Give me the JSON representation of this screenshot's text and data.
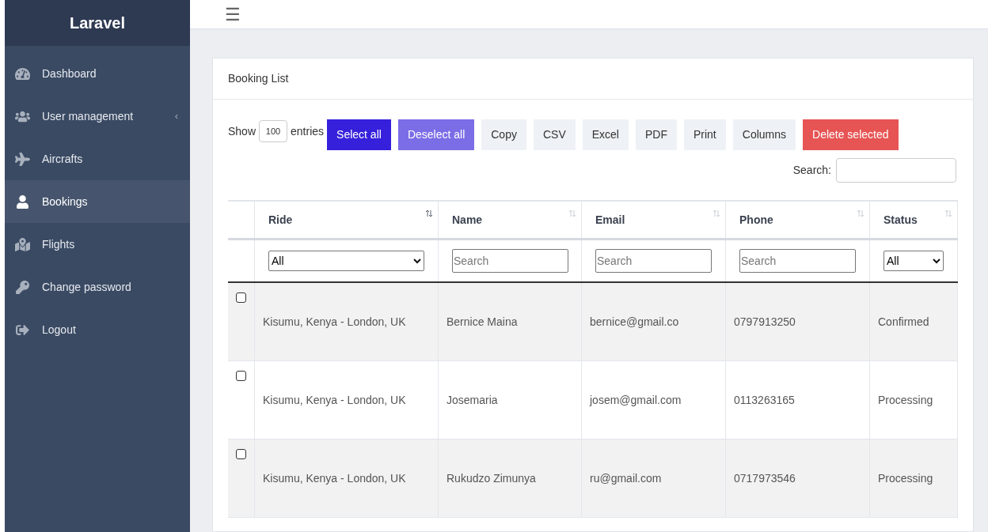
{
  "sidebar": {
    "brand": "Laravel",
    "items": [
      {
        "label": "Dashboard",
        "selected": false
      },
      {
        "label": "User management",
        "selected": false,
        "caret": "‹"
      },
      {
        "label": "Aircrafts",
        "selected": false
      },
      {
        "label": "Bookings",
        "selected": true
      },
      {
        "label": "Flights",
        "selected": false
      },
      {
        "label": "Change password",
        "selected": false
      },
      {
        "label": "Logout",
        "selected": false
      }
    ]
  },
  "header": {
    "menu_glyph": "☰"
  },
  "card": {
    "title": "Booking List",
    "length": {
      "before": "Show",
      "value": "100",
      "after": "entries"
    },
    "buttons": [
      {
        "label": "Select all",
        "kind": "primary"
      },
      {
        "label": "Deselect all",
        "kind": "secondary"
      },
      {
        "label": "Copy",
        "kind": "plain"
      },
      {
        "label": "CSV",
        "kind": "plain"
      },
      {
        "label": "Excel",
        "kind": "plain"
      },
      {
        "label": "PDF",
        "kind": "plain"
      },
      {
        "label": "Print",
        "kind": "plain"
      },
      {
        "label": "Columns",
        "kind": "plain"
      },
      {
        "label": "Delete selected",
        "kind": "danger"
      }
    ],
    "search_label": "Search:",
    "table": {
      "columns": [
        {
          "label": "Ride",
          "kind": "select",
          "value": "All"
        },
        {
          "label": "Name",
          "kind": "text",
          "placeholder": "Search"
        },
        {
          "label": "Email",
          "kind": "text",
          "placeholder": "Search"
        },
        {
          "label": "Phone",
          "kind": "text",
          "placeholder": "Search"
        },
        {
          "label": "Status",
          "kind": "select",
          "value": "All"
        }
      ],
      "rows": [
        {
          "checked": false,
          "cells": [
            "Kisumu, Kenya - London, UK",
            "Bernice Maina",
            "bernice@gmail.co",
            "0797913250",
            "Confirmed"
          ]
        },
        {
          "checked": false,
          "cells": [
            "Kisumu, Kenya - London, UK",
            "Josemaria",
            "josem@gmail.com",
            "0113263165",
            "Processing"
          ]
        },
        {
          "checked": false,
          "cells": [
            "Kisumu, Kenya - London, UK",
            "Rukudzo Zimunya",
            "ru@gmail.com",
            "0717973546",
            "Processing"
          ]
        }
      ]
    }
  }
}
